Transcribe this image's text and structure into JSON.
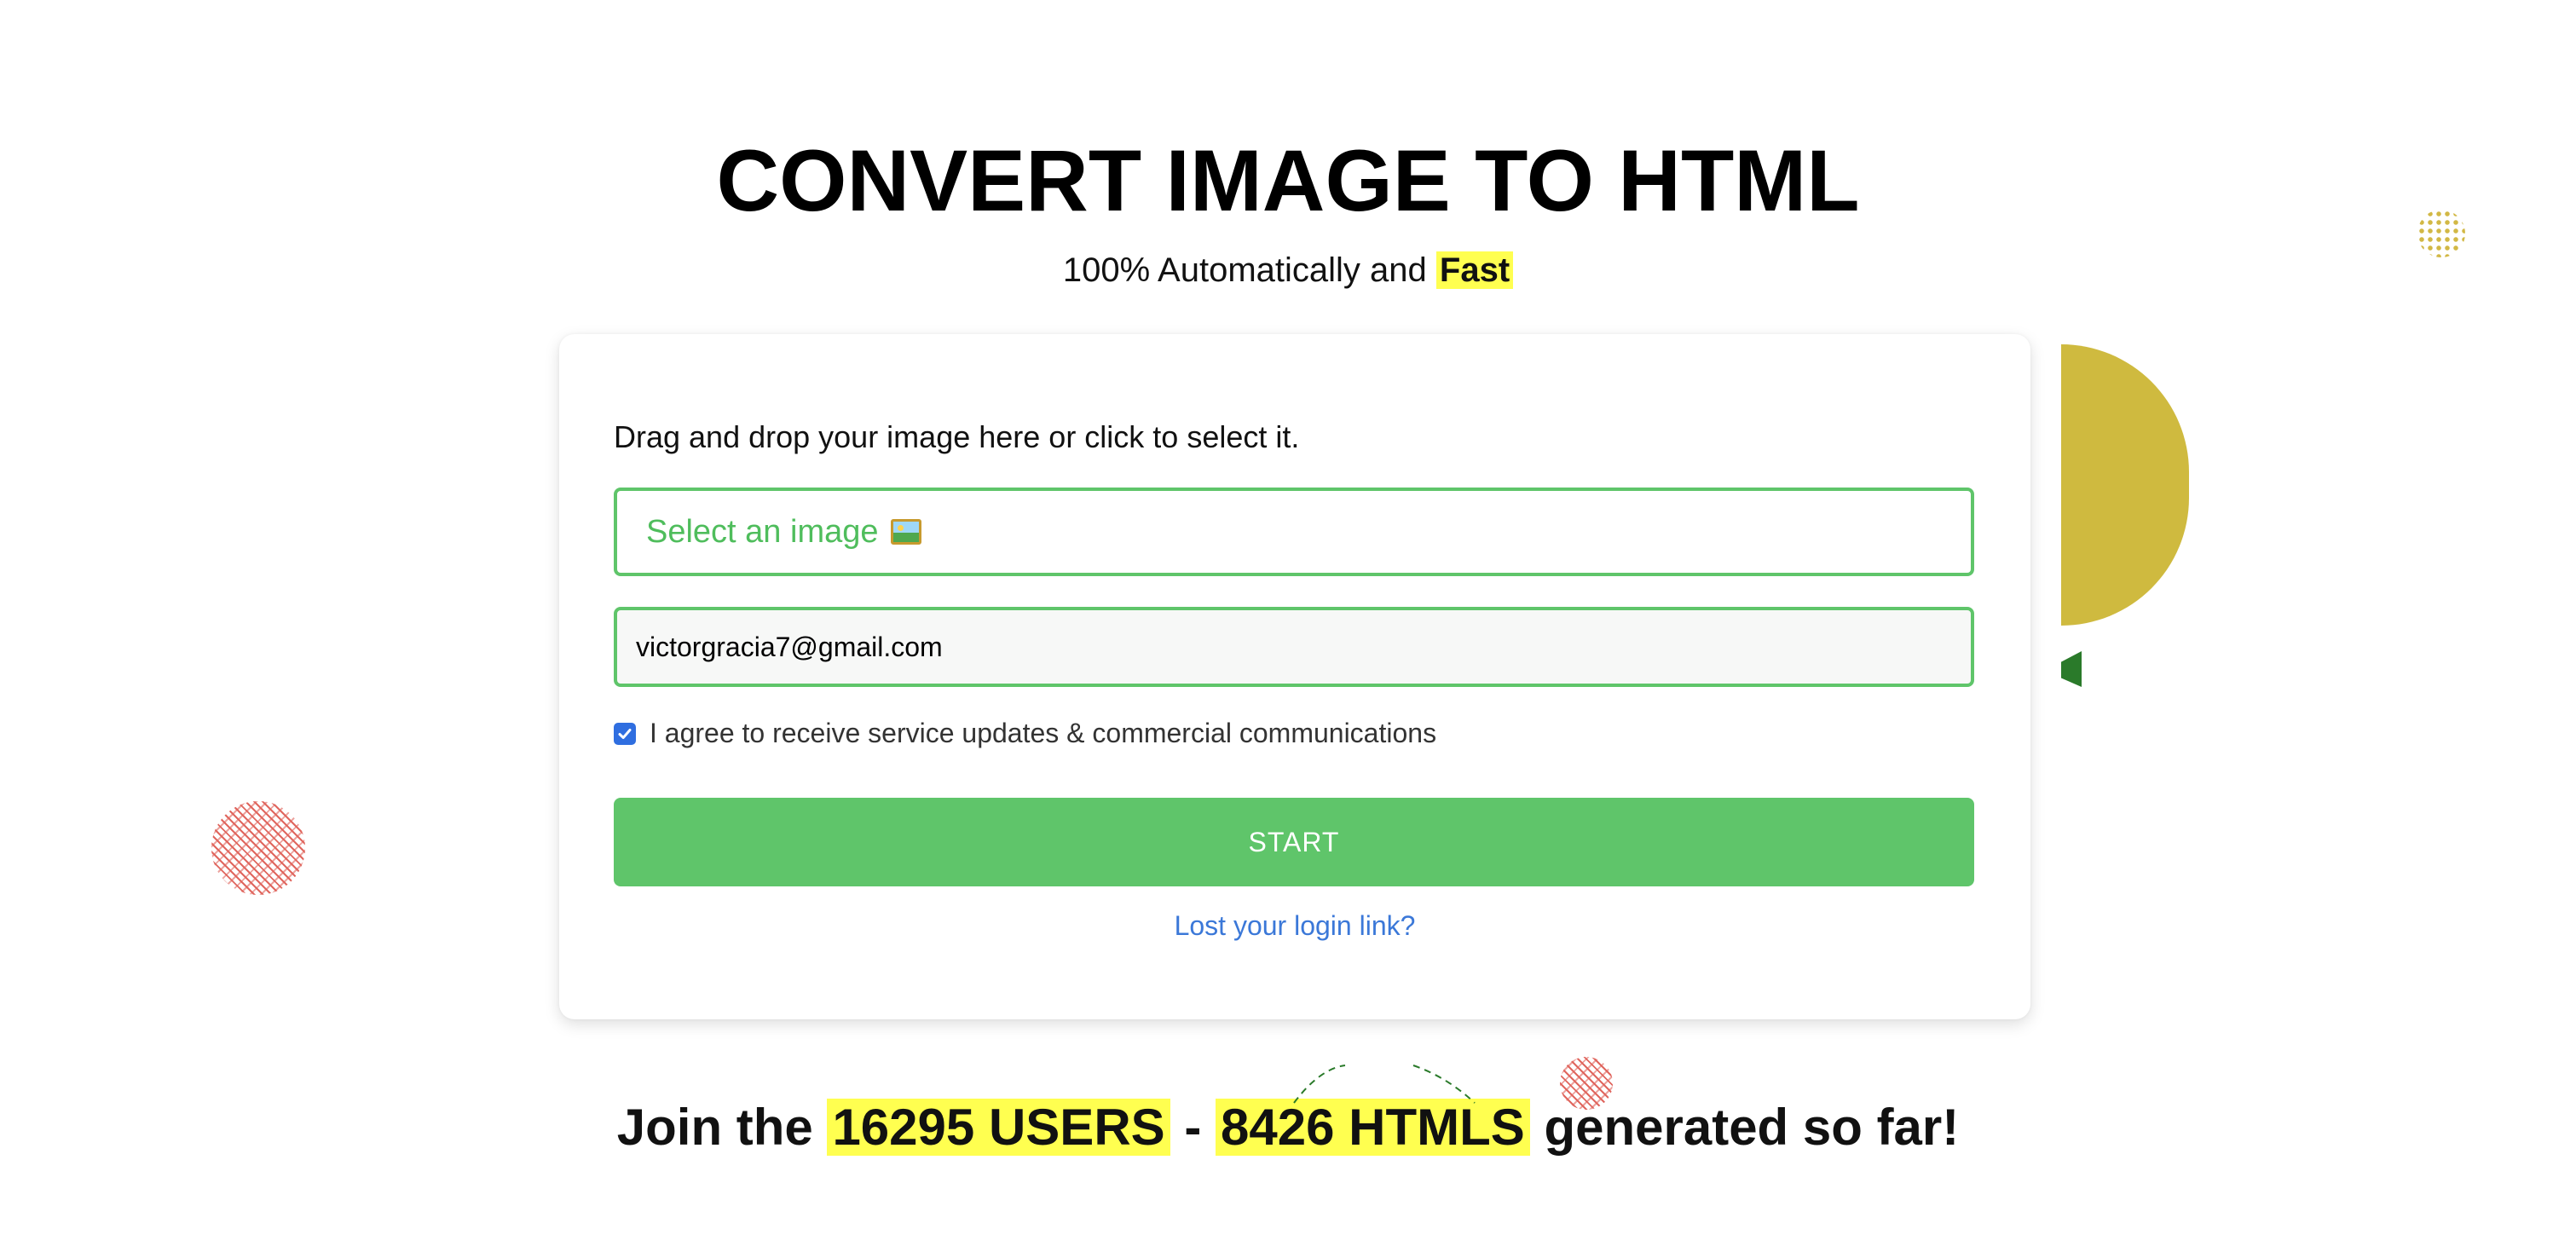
{
  "header": {
    "title": "CONVERT IMAGE TO HTML",
    "subtitle_prefix": "100% Automatically and",
    "subtitle_highlight": "Fast"
  },
  "form": {
    "instructions": "Drag and drop your image here or click to select it.",
    "file_placeholder": "Select an image",
    "file_icon": "framed-picture-icon",
    "email_value": "victorgracia7@gmail.com",
    "consent_label": "I agree to receive service updates & commercial communications",
    "consent_checked": true,
    "start_label": "START",
    "lost_link_label": "Lost your login link?"
  },
  "stats": {
    "prefix": "Join the",
    "users": "16295 USERS",
    "separator": "-",
    "htmls": "8426 HTMLS",
    "suffix": "generated so far!"
  },
  "colors": {
    "accent_green": "#5fc56a",
    "highlight_yellow": "#ffff50",
    "link_blue": "#3b78d8",
    "checkbox_blue": "#2f6ee0",
    "deco_gold": "#cfba3f",
    "deco_red": "#e0665e",
    "deco_green": "#2a7a2a"
  }
}
